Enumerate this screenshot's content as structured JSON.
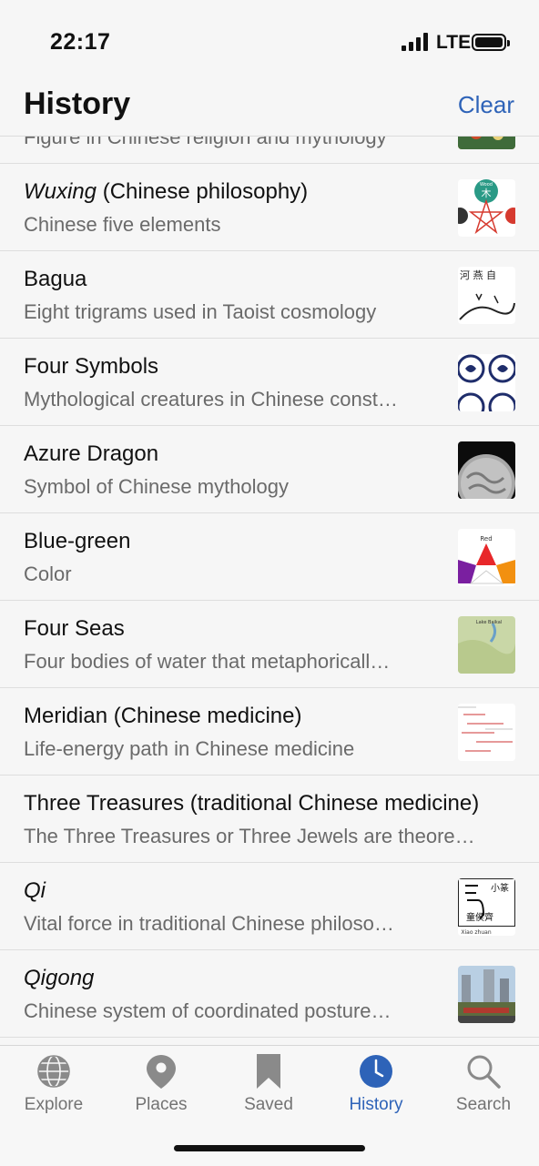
{
  "status": {
    "time": "22:17",
    "network": "LTE"
  },
  "header": {
    "title": "History",
    "clear_label": "Clear"
  },
  "items": [
    {
      "title": "",
      "title_italic": "",
      "desc": "Figure in Chinese religion and mythology",
      "thumb": "deity-painting"
    },
    {
      "title_italic": "Wuxing",
      "title": " (Chinese philosophy)",
      "desc": "Chinese five elements",
      "thumb": "wuxing-diagram"
    },
    {
      "title_italic": "",
      "title": "Bagua",
      "desc": "Eight trigrams used in Taoist cosmology",
      "thumb": "bagua-calligraphy"
    },
    {
      "title_italic": "",
      "title": "Four Symbols",
      "desc": "Mythological creatures in Chinese const…",
      "thumb": "four-symbols-tiles"
    },
    {
      "title_italic": "",
      "title": "Azure Dragon",
      "desc": "Symbol of Chinese mythology",
      "thumb": "dragon-coin"
    },
    {
      "title_italic": "",
      "title": "Blue-green",
      "desc": "Color",
      "thumb": "color-wheel"
    },
    {
      "title_italic": "",
      "title": "Four Seas",
      "desc": "Four bodies of water that metaphoricall…",
      "thumb": "map-lake-baikal"
    },
    {
      "title_italic": "",
      "title": "Meridian (Chinese medicine)",
      "desc": "Life-energy path in Chinese medicine",
      "thumb": "meridian-chart"
    },
    {
      "title_italic": "",
      "title": "Three Treasures (traditional Chinese medicine)",
      "desc": "The Three Treasures or Three Jewels are theore…",
      "thumb": ""
    },
    {
      "title_italic": "Qi",
      "title": "",
      "desc": "Vital force in traditional Chinese philoso…",
      "thumb": "qi-character"
    },
    {
      "title_italic": "Qigong",
      "title": "",
      "desc": "Chinese system of coordinated posture…",
      "thumb": "qigong-photo"
    }
  ],
  "thumb_text": {
    "wuxing": "Wood",
    "wuxing_char": "木",
    "color_wheel": "Red",
    "map": "Lake Baikal",
    "bagua": "河 燕 自",
    "qi_chars": "小篆",
    "qi_seal": "童侯齊",
    "qi_caption": "Xiao zhuan"
  },
  "tabs": [
    {
      "label": "Explore",
      "icon": "globe-icon"
    },
    {
      "label": "Places",
      "icon": "map-pin-icon"
    },
    {
      "label": "Saved",
      "icon": "bookmark-icon"
    },
    {
      "label": "History",
      "icon": "clock-icon",
      "active": true
    },
    {
      "label": "Search",
      "icon": "search-icon"
    }
  ],
  "colors": {
    "accent": "#2e63b8",
    "text_secondary": "#6a6a6a"
  }
}
